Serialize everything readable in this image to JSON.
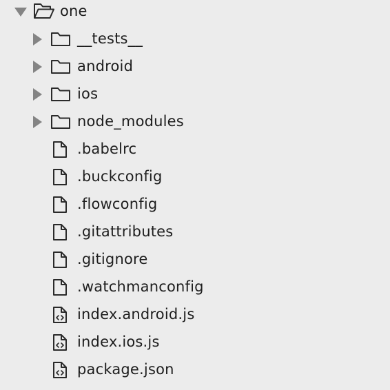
{
  "root": {
    "label": "one",
    "icon": "folder-open-icon",
    "expanded": true
  },
  "items": [
    {
      "label": "__tests__",
      "type": "folder",
      "icon": "folder-icon"
    },
    {
      "label": "android",
      "type": "folder",
      "icon": "folder-icon"
    },
    {
      "label": "ios",
      "type": "folder",
      "icon": "folder-icon"
    },
    {
      "label": "node_modules",
      "type": "folder",
      "icon": "folder-icon"
    },
    {
      "label": ".babelrc",
      "type": "file",
      "icon": "file-icon"
    },
    {
      "label": ".buckconfig",
      "type": "file",
      "icon": "file-icon"
    },
    {
      "label": ".flowconfig",
      "type": "file",
      "icon": "file-icon"
    },
    {
      "label": ".gitattributes",
      "type": "file",
      "icon": "file-icon"
    },
    {
      "label": ".gitignore",
      "type": "file",
      "icon": "file-icon"
    },
    {
      "label": ".watchmanconfig",
      "type": "file",
      "icon": "file-icon"
    },
    {
      "label": "index.android.js",
      "type": "code",
      "icon": "code-file-icon"
    },
    {
      "label": "index.ios.js",
      "type": "code",
      "icon": "code-file-icon"
    },
    {
      "label": "package.json",
      "type": "code",
      "icon": "code-file-icon"
    }
  ]
}
